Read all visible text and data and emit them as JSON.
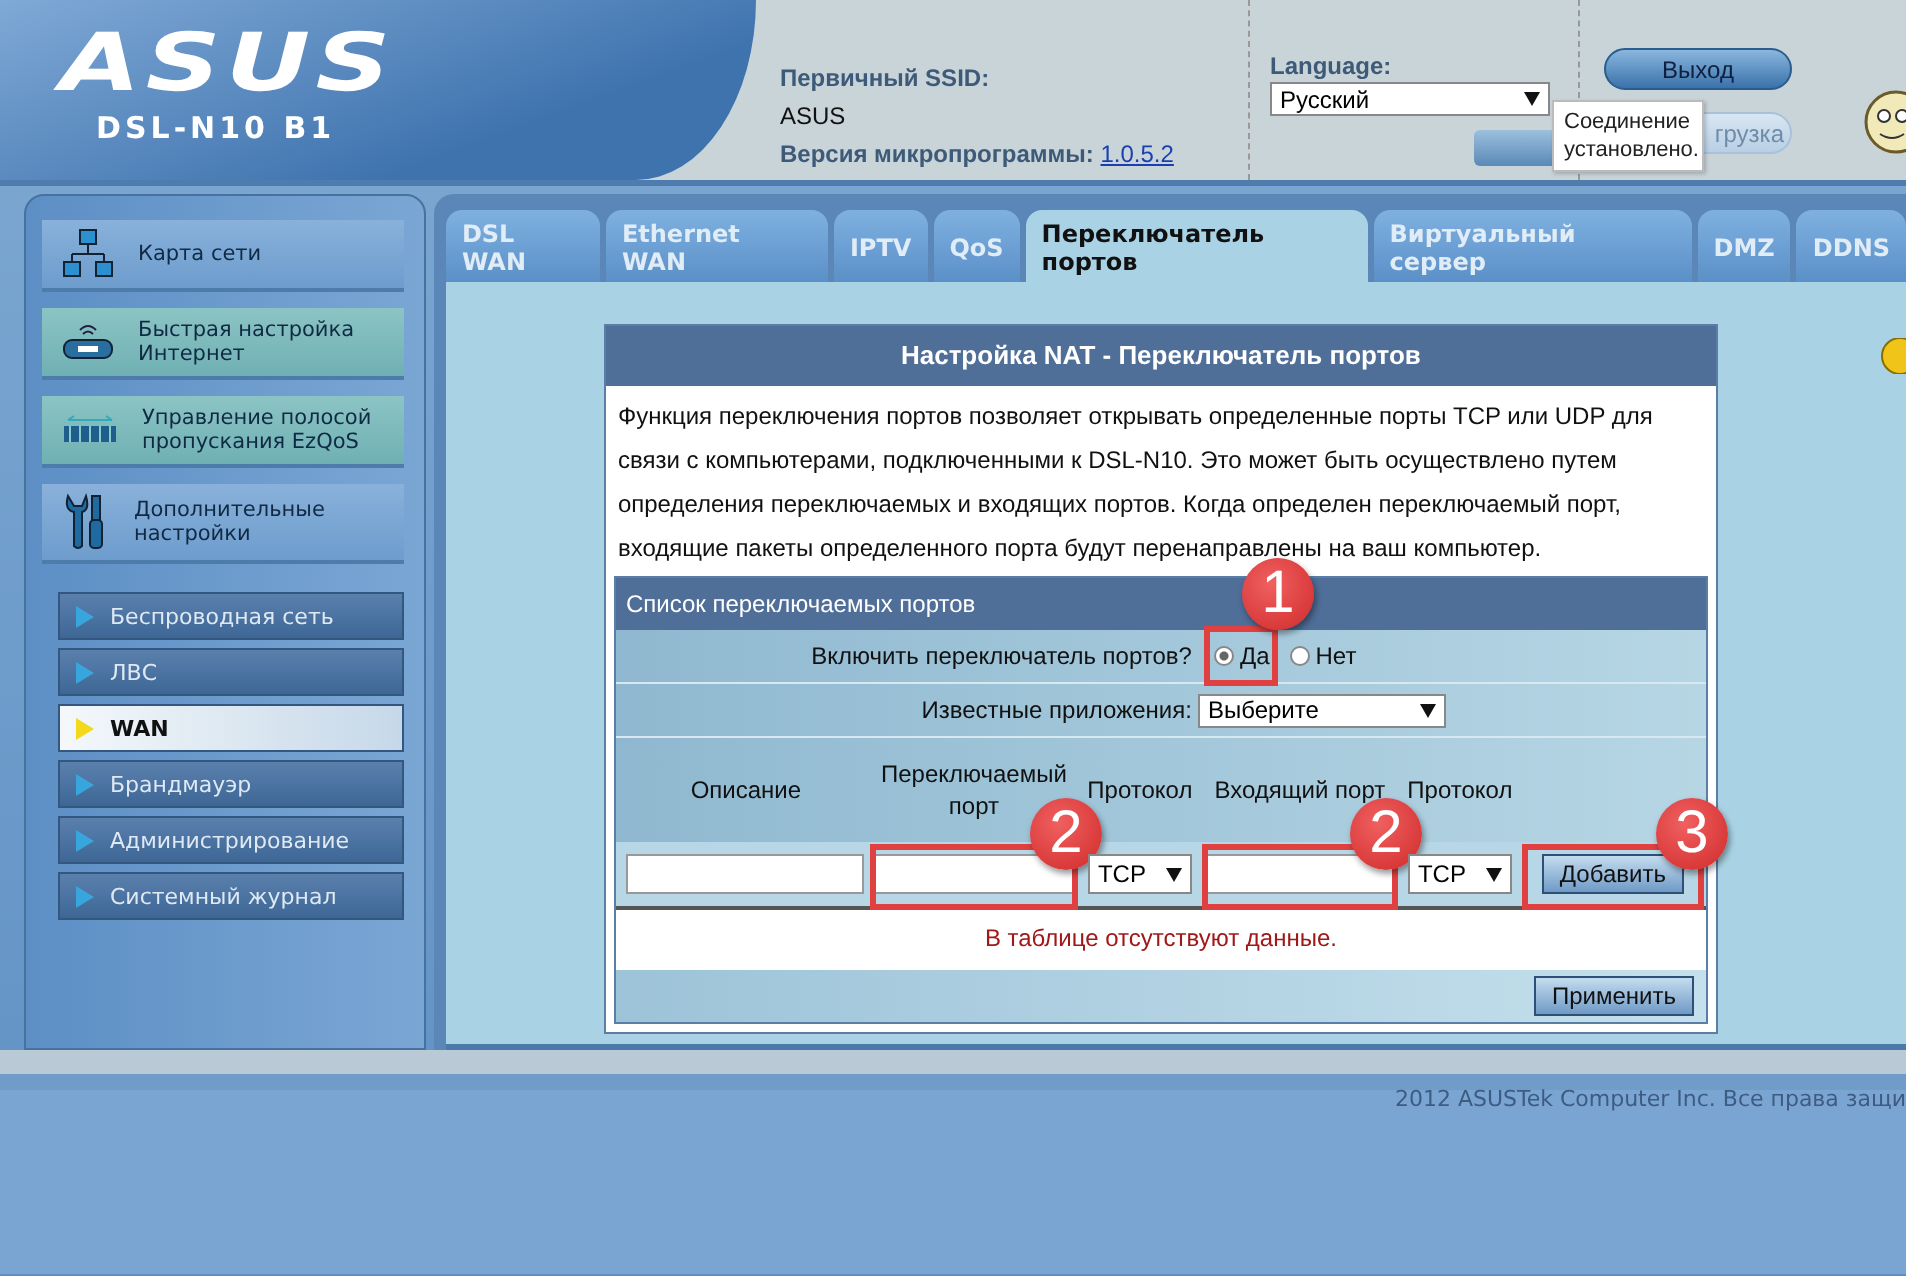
{
  "header": {
    "logo": "ASUS",
    "model": "DSL-N10 B1",
    "ssid_label": "Первичный SSID:",
    "ssid": "ASUS",
    "firmware_label": "Версия микропрограммы:",
    "firmware": "1.0.5.2",
    "language_label": "Language:",
    "language": "Русский",
    "logout": "Выход",
    "reboot": "грузка",
    "tooltip": "Соединение установлено."
  },
  "sidebar": {
    "main_items": [
      {
        "label": "Карта сети",
        "kind": "network"
      },
      {
        "label": "Быстрая настройка Интернет",
        "kind": "router"
      },
      {
        "label": "Управление полосой пропускания EzQoS",
        "kind": "qos"
      },
      {
        "label": "Дополнительные настройки",
        "kind": "tools"
      }
    ],
    "sub_items": [
      {
        "label": "Беспроводная сеть",
        "selected": false
      },
      {
        "label": "ЛВС",
        "selected": false
      },
      {
        "label": "WAN",
        "selected": true
      },
      {
        "label": "Брандмауэр",
        "selected": false
      },
      {
        "label": "Администрирование",
        "selected": false
      },
      {
        "label": "Системный журнал",
        "selected": false
      }
    ]
  },
  "tabs": [
    {
      "label": "DSL WAN",
      "selected": false
    },
    {
      "label": "Ethernet WAN",
      "selected": false
    },
    {
      "label": "IPTV",
      "selected": false
    },
    {
      "label": "QoS",
      "selected": false
    },
    {
      "label": "Переключатель портов",
      "selected": true
    },
    {
      "label": "Виртуальный сервер",
      "selected": false
    },
    {
      "label": "DMZ",
      "selected": false
    },
    {
      "label": "DDNS",
      "selected": false
    }
  ],
  "panel": {
    "title": "Настройка NAT - Переключатель портов",
    "description": "Функция переключения портов позволяет открывать определенные порты TCP или UDP для связи с компьютерами, подключенными к DSL-N10. Это может быть осуществлено путем определения переключаемых и входящих портов. Когда определен переключаемый порт, входящие пакеты определенного порта будут перенаправлены на ваш компьютер.",
    "list_title": "Список переключаемых портов",
    "enable_label": "Включить переключатель портов?",
    "enable_options": [
      {
        "label": "Да",
        "selected": true,
        "marker": "1"
      },
      {
        "label": "Нет",
        "selected": false
      }
    ],
    "apps_label": "Известные приложения:",
    "apps_value": "Выберите",
    "columns": [
      "Описание",
      "Переключаемый порт",
      "Протокол",
      "Входящий порт",
      "Протокол"
    ],
    "entry_row": [
      {
        "kind": "input"
      },
      {
        "kind": "input",
        "marker": "2"
      },
      {
        "kind": "select",
        "value": "TCP"
      },
      {
        "kind": "input",
        "marker": "2"
      },
      {
        "kind": "select",
        "value": "TCP"
      },
      {
        "kind": "button",
        "label": "Добавить",
        "marker": "3"
      }
    ],
    "empty_message": "В таблице отсутствуют данные.",
    "apply": "Применить"
  },
  "footer": {
    "copyright": "2012 ASUSTek Computer Inc. Все права защи"
  }
}
